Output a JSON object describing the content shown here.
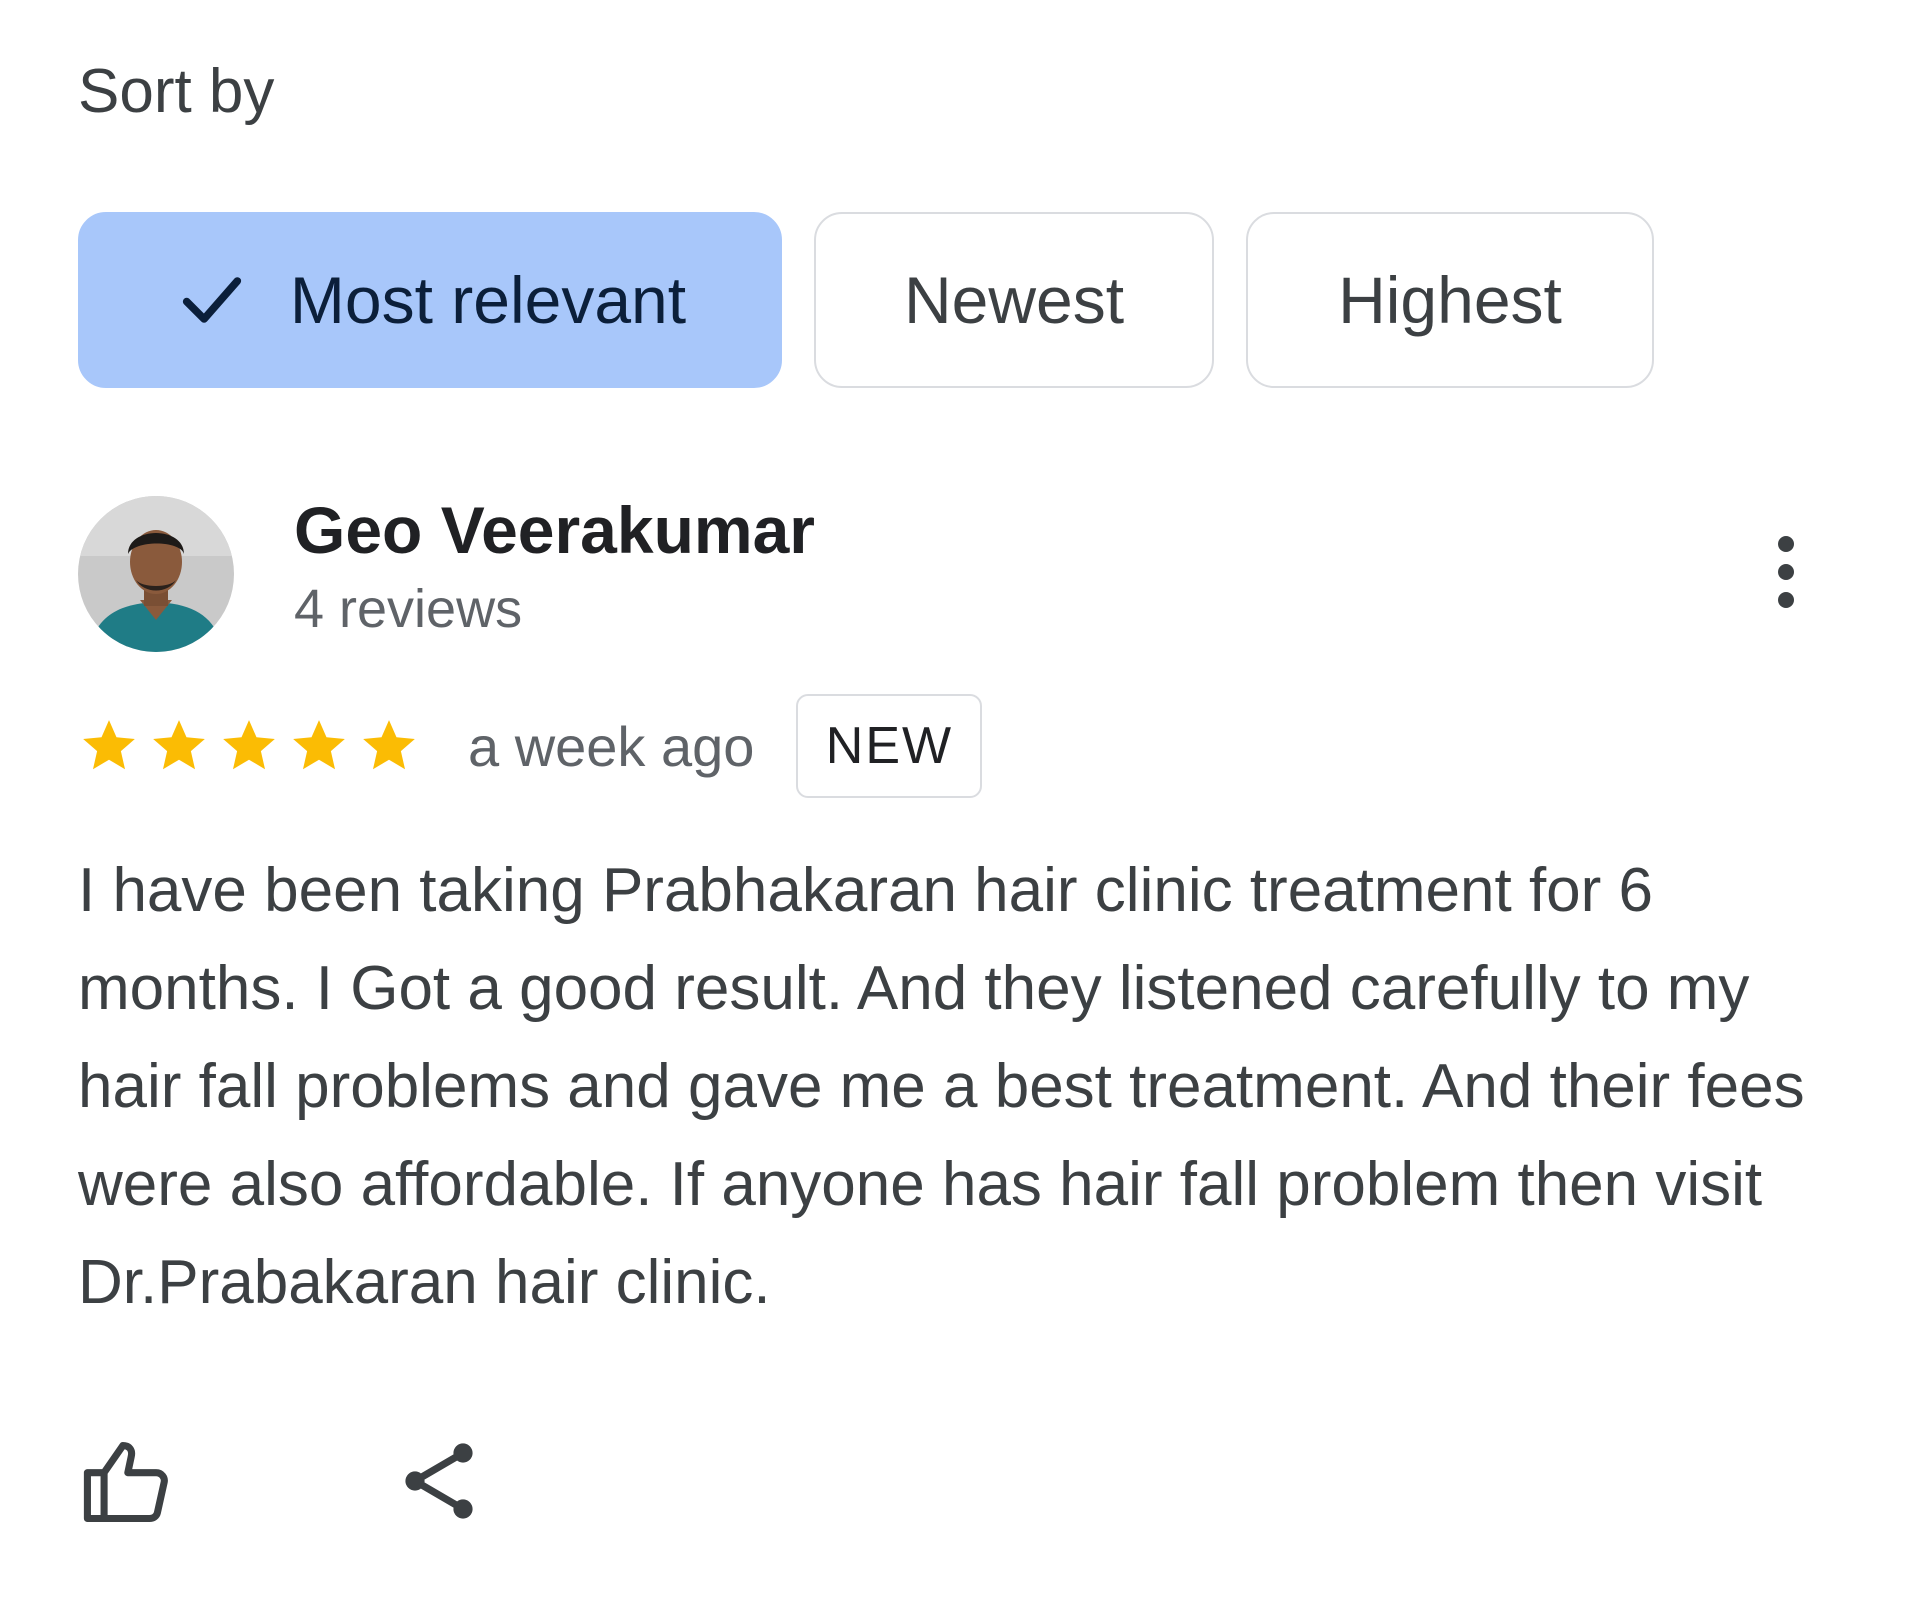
{
  "sort": {
    "label": "Sort by",
    "options": [
      {
        "label": "Most relevant",
        "selected": true
      },
      {
        "label": "Newest",
        "selected": false
      },
      {
        "label": "Highest",
        "selected": false
      }
    ]
  },
  "review": {
    "author": {
      "name": "Geo Veerakumar",
      "meta": "4 reviews"
    },
    "rating": 5,
    "rating_max": 5,
    "time": "a week ago",
    "badge": "NEW",
    "text": "I have been taking Prabhakaran hair clinic treatment for 6 months. I Got a good result. And they listened carefully to my hair fall problems and gave me a best treatment. And their fees were also affordable. If anyone has hair fall problem then visit Dr.Prabakaran hair clinic."
  },
  "icons": {
    "check": "check-icon",
    "more": "more-vert-icon",
    "star": "star-icon",
    "like": "thumb-up-icon",
    "share": "share-icon"
  },
  "colors": {
    "selected_chip": "#a8c7fa",
    "star": "#fbbc04",
    "border": "#dadce0"
  }
}
